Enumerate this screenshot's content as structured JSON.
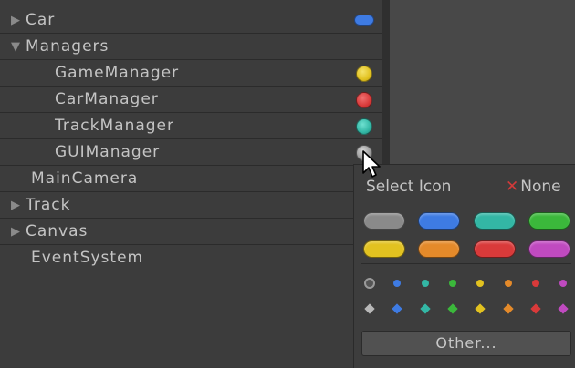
{
  "hierarchy": {
    "items": [
      {
        "label": "Car",
        "expander": "▶",
        "icon": "blue-pill-icon",
        "icon_color": "#3e7be3"
      },
      {
        "label": "Managers",
        "expander": "▼"
      },
      {
        "label": "GameManager",
        "icon": "yellow-circle-icon",
        "icon_color": "#e2c220"
      },
      {
        "label": "CarManager",
        "icon": "red-circle-icon",
        "icon_color": "#d93a3a"
      },
      {
        "label": "TrackManager",
        "icon": "teal-circle-icon",
        "icon_color": "#33b7a5"
      },
      {
        "label": "GUIManager",
        "icon": "gray-circle-icon",
        "icon_color": "#9a9a9a"
      },
      {
        "label": "MainCamera"
      },
      {
        "label": "Track",
        "expander": "▶"
      },
      {
        "label": "Canvas",
        "expander": "▶"
      },
      {
        "label": "EventSystem"
      }
    ]
  },
  "picker": {
    "title": "Select Icon",
    "none_label": "None",
    "other_label": "Other...",
    "label_colors": [
      "#8a8a8a",
      "#3e7be3",
      "#33b7a5",
      "#3bb83b",
      "#e2c220",
      "#e48a2a",
      "#d93a3a",
      "#c04ac0"
    ],
    "dot_colors": [
      "#3e7be3",
      "#33b7a5",
      "#3bb83b",
      "#e2c220",
      "#e48a2a",
      "#d93a3a",
      "#c04ac0"
    ],
    "diamond_colors": [
      "#b8b8b8",
      "#3e7be3",
      "#33b7a5",
      "#3bb83b",
      "#e2c220",
      "#e48a2a",
      "#d93a3a",
      "#c04ac0"
    ]
  }
}
